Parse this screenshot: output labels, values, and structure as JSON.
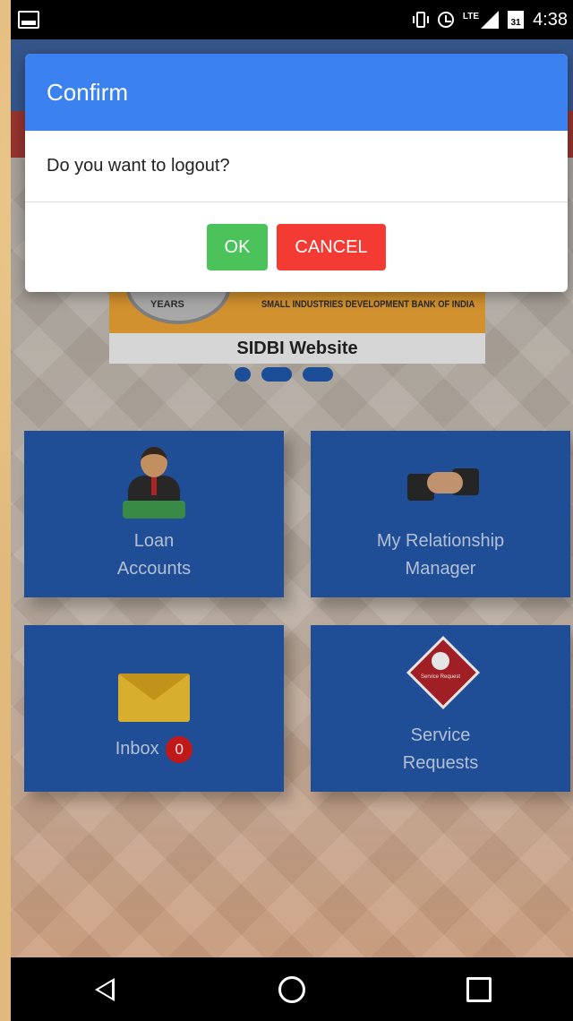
{
  "status_bar": {
    "time": "4:38",
    "calendar_day": "31",
    "network_type": "LTE",
    "icons": [
      "image-notification-icon",
      "vibrate-icon",
      "alarm-icon",
      "signal-icon",
      "calendar-icon"
    ]
  },
  "banner": {
    "seal_text": "YEARS",
    "org_name": "SMALL INDUSTRIES DEVELOPMENT BANK OF INDIA",
    "caption": "SIDBI Website",
    "pages": 3,
    "active_page": 1
  },
  "tiles": {
    "loan": {
      "line1": "Loan",
      "line2": "Accounts",
      "icon": "businessman-money-icon"
    },
    "manager": {
      "line1": "My Relationship",
      "line2": "Manager",
      "icon": "handshake-icon"
    },
    "inbox": {
      "label": "Inbox",
      "badge": "0",
      "icon": "envelope-icon"
    },
    "service": {
      "line1": "Service",
      "line2": "Requests",
      "icon": "service-request-icon",
      "icon_text": "Service Request"
    }
  },
  "dialog": {
    "title": "Confirm",
    "message": "Do you want to logout?",
    "ok_label": "OK",
    "cancel_label": "CANCEL"
  },
  "nav": {
    "icons": [
      "back-icon",
      "home-icon",
      "recent-apps-icon"
    ]
  },
  "colors": {
    "dialog_header": "#3b82f0",
    "ok_button": "#4cc35a",
    "cancel_button": "#f33a33",
    "tile": "#2457a7",
    "badge": "#d61c1c"
  }
}
